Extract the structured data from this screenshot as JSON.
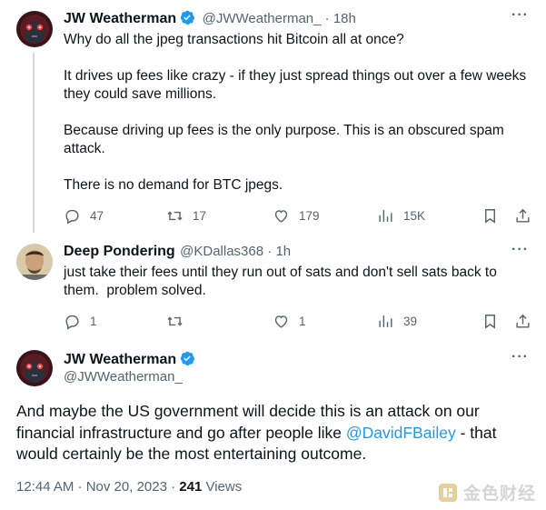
{
  "tweets": [
    {
      "name": "JW Weatherman",
      "verified": true,
      "handle": "@JWWeatherman_",
      "time": "18h",
      "text": "Why do all the jpeg transactions hit Bitcoin all at once?\n\nIt drives up fees like crazy - if they just spread things out over a few weeks they could save millions.\n\nBecause driving up fees is the only purpose. This is an obscured spam attack.\n\nThere is no demand for BTC jpegs.",
      "replies": "47",
      "retweets": "17",
      "likes": "179",
      "views": "15K"
    },
    {
      "name": "Deep Pondering",
      "handle": "@KDallas368",
      "time": "1h",
      "text": "just take their fees until they run out of sats and don't sell sats back to them.  problem solved.",
      "replies": "1",
      "retweets": "",
      "likes": "1",
      "views": "39"
    }
  ],
  "main": {
    "name": "JW Weatherman",
    "handle": "@JWWeatherman_",
    "text_before": "And maybe the US government will decide this is an attack on our financial infrastructure and go after people like ",
    "mention": "@DavidFBailey",
    "text_after": " - that would certainly be the most entertaining outcome.",
    "timestamp": "12:44 AM · Nov 20, 2023 · ",
    "views_count": "241",
    "views_label": " Views"
  },
  "separator": " · ",
  "watermark": "金色财经",
  "colors": {
    "accent": "#1d9bf0",
    "text": "#0f1419",
    "secondary": "#536471",
    "divider": "#cfd9de"
  },
  "icons": [
    "verified-badge-icon",
    "reply-icon",
    "retweet-icon",
    "like-icon",
    "views-icon",
    "bookmark-icon",
    "share-icon",
    "more-icon"
  ]
}
